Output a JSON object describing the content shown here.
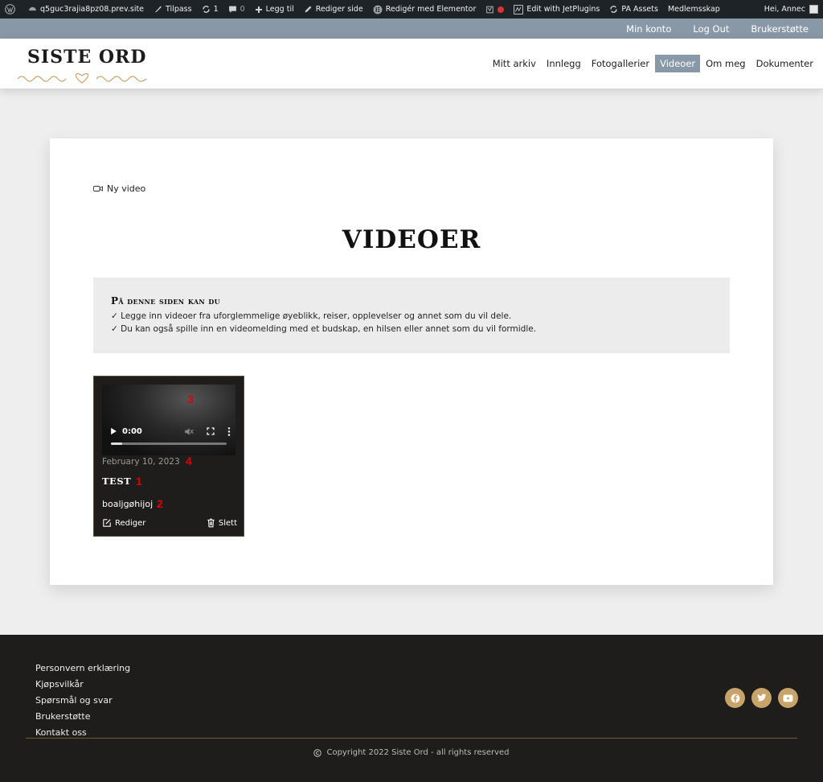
{
  "adminbar": {
    "site": "q5guc3rajia8pz08.prev.site",
    "customize": "Tilpass",
    "updates": "1",
    "comments": "0",
    "add_new": "Legg til",
    "edit_page": "Rediger side",
    "elementor": "Redigér med Elementor",
    "jetplugins": "Edit with JetPlugins",
    "pa_assets": "PA Assets",
    "membership": "Medlemsskap",
    "greeting": "Hei, Annec"
  },
  "topbar": {
    "my_account": "Min konto",
    "logout": "Log Out",
    "support": "Brukerstøtte"
  },
  "header": {
    "logo_text": "SISTE ORD",
    "nav": [
      "Mitt arkiv",
      "Innlegg",
      "Fotogallerier",
      "Videoer",
      "Om meg",
      "Dokumenter"
    ],
    "active_nav": "Videoer",
    "accent_color": "#8898a6"
  },
  "main": {
    "new_video": "Ny video",
    "title": "VIDEOER",
    "info": {
      "heading": "På denne siden kan du",
      "lines": [
        "✓  Legge inn videoer fra uforglemmelige øyeblikk, reiser, opplevelser og annet som du vil dele.",
        "✓  Du kan også spille inn en videomelding med et budskap, en hilsen eller annet som du vil formidle."
      ]
    },
    "video_card": {
      "time": "0:00",
      "progress": 0.1,
      "date": "February 10, 2023",
      "title": "TEST",
      "description": "boaljgøhijoj",
      "edit_label": "Rediger",
      "delete_label": "Slett",
      "markers": [
        "3",
        "4",
        "1",
        "2"
      ]
    }
  },
  "footer": {
    "links": [
      "Personvern erklæring",
      "Kjøpsvilkår",
      "Spørsmål og svar",
      "Brukerstøtte",
      "Kontakt oss"
    ],
    "social": [
      "facebook-icon",
      "twitter-icon",
      "youtube-icon"
    ],
    "copyright": "Copyright 2022 Siste Ord - all rights reserved",
    "accent_color": "#c9a46a"
  }
}
